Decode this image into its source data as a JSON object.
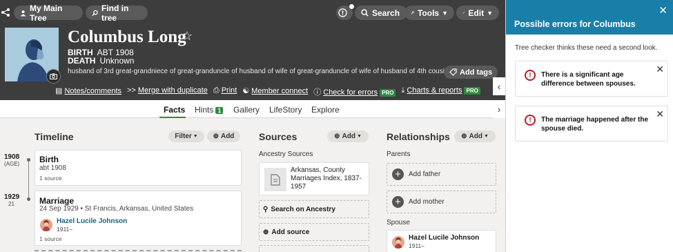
{
  "topbar": {
    "tree_label": "My Main Tree",
    "find_label": "Find in tree",
    "search_label": "Search",
    "tools_label": "Tools",
    "edit_label": "Edit"
  },
  "profile": {
    "name": "Columbus Long",
    "birth_label": "BIRTH",
    "birth_value": "ABT 1908",
    "death_label": "DEATH",
    "death_value": "Unknown",
    "relationship": "husband of 3rd great-grandniece of great-granduncle of husband of wife of great-granduncle of wife of husband of 4th cousin",
    "add_tags": "Add tags"
  },
  "actions": [
    {
      "label": "Notes/comments",
      "pro": false
    },
    {
      "label": "Merge with duplicate",
      "pro": false
    },
    {
      "label": "Print",
      "pro": false
    },
    {
      "label": "Member connect",
      "pro": false
    },
    {
      "label": "Check for errors",
      "pro": true
    },
    {
      "label": "Charts & reports",
      "pro": true
    }
  ],
  "pro_label": "PRO",
  "tabs": {
    "facts": "Facts",
    "hints": "Hints",
    "hints_count": "1",
    "gallery": "Gallery",
    "lifestory": "LifeStory",
    "explore": "Explore"
  },
  "timeline": {
    "title": "Timeline",
    "filter": "Filter",
    "add": "Add",
    "events": [
      {
        "year": "1908",
        "age": "(AGE)",
        "title": "Birth",
        "detail": "abt 1908",
        "sources": "1 source"
      },
      {
        "year": "1929",
        "age": "21",
        "title": "Marriage",
        "detail": "24 Sep 1929 • St Francis, Arkansas, United States",
        "spouse": "Hazel Lucile Johnson",
        "spouse_years": "1911–",
        "sources": "1 source"
      }
    ]
  },
  "sources": {
    "title": "Sources",
    "add": "Add",
    "group": "Ancestry Sources",
    "item": "Arkansas, County Marriages Index, 1837-1957",
    "search": "Search on Ancestry",
    "add_source": "Add source"
  },
  "relationships": {
    "title": "Relationships",
    "add": "Add",
    "parents": "Parents",
    "add_father": "Add father",
    "add_mother": "Add mother",
    "spouse_label": "Spouse",
    "spouse_name": "Hazel Lucile Johnson",
    "spouse_years": "1911–"
  },
  "panel": {
    "title": "Possible errors for Columbus",
    "intro": "Tree checker thinks these need a second look.",
    "errors": [
      "There is a significant age difference between spouses.",
      "The marriage happened after the spouse died."
    ]
  },
  "colors": {
    "header_bg": "#3d3d3d",
    "accent_green": "#2c8a3e",
    "panel_blue": "#1a7fa8",
    "error_red": "#b51b24"
  }
}
